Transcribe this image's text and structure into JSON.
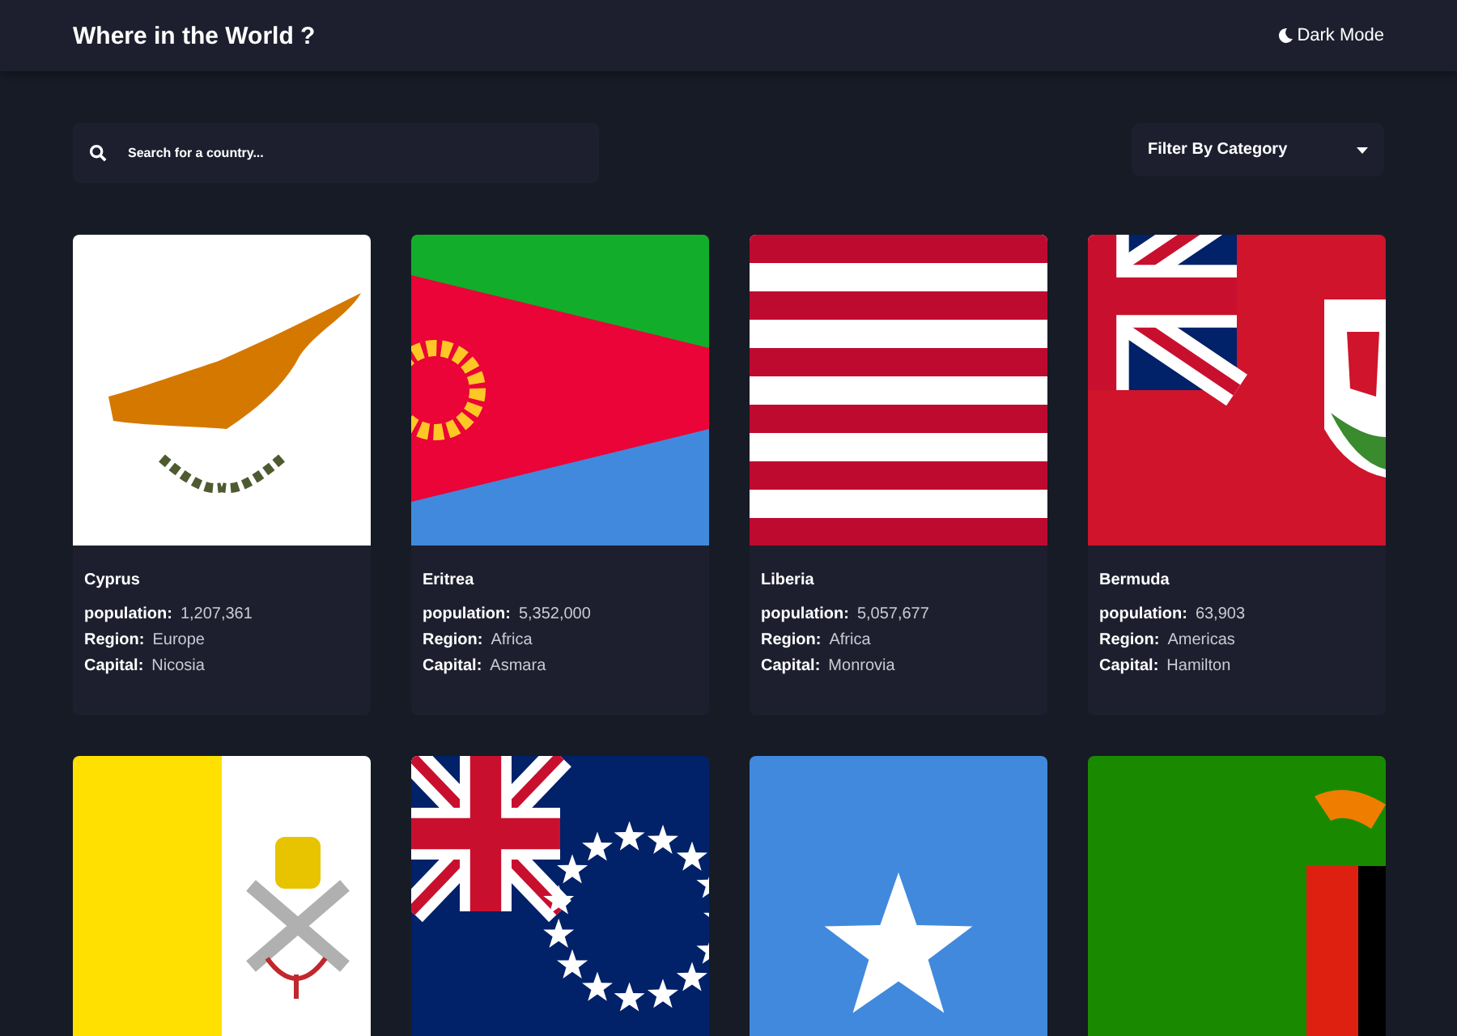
{
  "header": {
    "title": "Where in the World ?",
    "theme_toggle": "Dark Mode"
  },
  "search": {
    "placeholder": "Search for a country..."
  },
  "filter": {
    "label": "Filter By Category"
  },
  "countries": [
    {
      "kind": "cyprus",
      "name": "Cyprus",
      "stats": [
        {
          "label": "population:",
          "value": "1,207,361"
        },
        {
          "label": "Region:",
          "value": "Europe"
        },
        {
          "label": "Capital:",
          "value": "Nicosia"
        }
      ]
    },
    {
      "kind": "eritrea",
      "name": "Eritrea",
      "stats": [
        {
          "label": "population:",
          "value": "5,352,000"
        },
        {
          "label": "Region:",
          "value": "Africa"
        },
        {
          "label": "Capital:",
          "value": "Asmara"
        }
      ]
    },
    {
      "kind": "liberia",
      "name": "Liberia",
      "stats": [
        {
          "label": "population:",
          "value": "5,057,677"
        },
        {
          "label": "Region:",
          "value": "Africa"
        },
        {
          "label": "Capital:",
          "value": "Monrovia"
        }
      ]
    },
    {
      "kind": "bermuda",
      "name": "Bermuda",
      "stats": [
        {
          "label": "population:",
          "value": "63,903"
        },
        {
          "label": "Region:",
          "value": "Americas"
        },
        {
          "label": "Capital:",
          "value": "Hamilton"
        }
      ]
    },
    {
      "kind": "vatican"
    },
    {
      "kind": "cook-islands"
    },
    {
      "kind": "somalia"
    },
    {
      "kind": "zambia"
    }
  ]
}
